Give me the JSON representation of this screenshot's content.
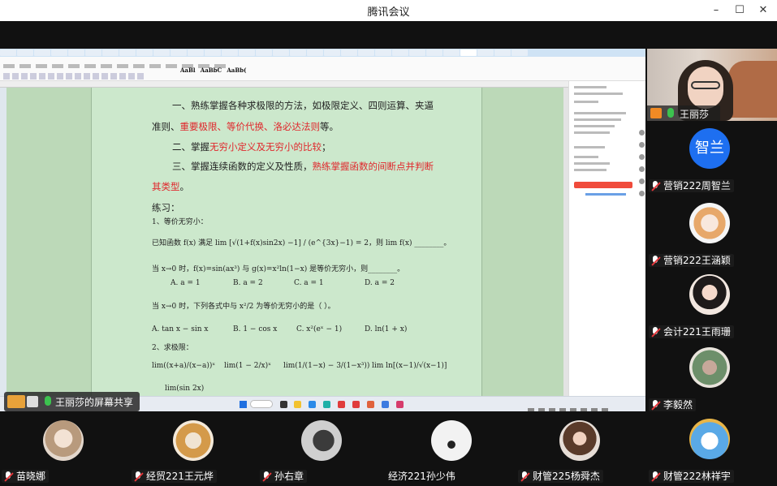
{
  "window": {
    "title": "腾讯会议",
    "controls": {
      "minimize": "–",
      "maximize": "☐",
      "close": "✕"
    }
  },
  "doc": {
    "line1_prefix": "一、熟练掌握各种求极限的方法，如极限定义、四则运算、夹逼",
    "line2_prefix": "准则、",
    "line2_red": "重要极限、等价代换、洛必达法则",
    "line2_suffix": "等。",
    "line3_prefix": "二、掌握",
    "line3_red": "无穷小定义及无穷小的比较",
    "line3_suffix": "；",
    "line4_prefix": "三、掌握连续函数的定义及性质，",
    "line4_red": "熟练掌握函数的间断点并判断",
    "line5_red": "其类型",
    "line5_suffix": "。",
    "exercise_title": "练习：",
    "q1_title": "1、等价无穷小：",
    "q1_text": "已知函数 f(x) 满足 lim [√(1+f(x)sin2x) −1] / (e^{3x}−1) = 2，则 lim f(x) ________。",
    "q2_text": "当 x→0 时，f(x)=sin(ax³) 与 g(x)=x²ln(1−x) 是等价无穷小，则________。",
    "q2_options": [
      "A.  a = 1",
      "B.  a = 2",
      "C.  a = 1",
      "D.  a = 2"
    ],
    "q3_text": "当 x→0 时，下列各式中与 x²/2 为等价无穷小的是（    ）。",
    "q3_options": [
      "A.  tan x − sin x",
      "B.  1 − cos x",
      "C.  x²(eˣ − 1)",
      "D.  ln(1 + x)"
    ],
    "q4_title": "2、求极限：",
    "q4_items": [
      "lim((x+a)/(x−a))ˣ",
      "lim(1 − 2/x)ˣ",
      "lim(1/(1−x) − 3/(1−x³))",
      "lim ln[(x−1)/√(x−1)]"
    ],
    "q4_last": "lim(sin 2x)"
  },
  "ribbon": {
    "styles": [
      "AaBl",
      "AaBbC",
      "AaBb("
    ]
  },
  "share_label": "王丽莎的屏幕共享",
  "self_video": {
    "name": "王丽莎"
  },
  "right_participants": [
    {
      "name": "营销222周智兰",
      "avatar_text": "智兰"
    },
    {
      "name": "营销222王涵颖"
    },
    {
      "name": "会计221王雨珊"
    },
    {
      "name": "李毅然"
    },
    {
      "name": "财管222林祥宇"
    }
  ],
  "bottom_participants": [
    {
      "name": "苗晓娜"
    },
    {
      "name": "经贸221王元烨"
    },
    {
      "name": "孙右章"
    },
    {
      "name": "经济221孙少伟"
    },
    {
      "name": "财管225杨舜杰"
    }
  ],
  "colors": {
    "accent_red": "#e0262b",
    "doc_green": "#cce8cc",
    "avatar_blue": "#1e6ff0"
  }
}
